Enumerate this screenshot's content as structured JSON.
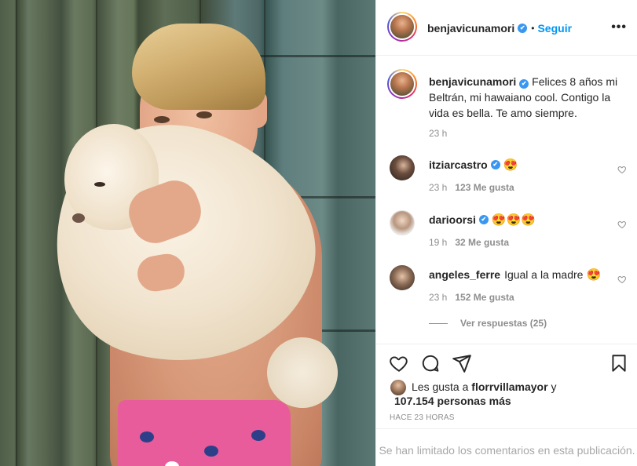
{
  "post": {
    "author": "benjavicunamori",
    "follow_label": "Seguir",
    "header_dot": "•",
    "more_label": "•••",
    "verified_mark": "✔",
    "caption": "Felices 8 años mi Beltrán, mi hawaiano cool. Contigo la vida es bella. Te amo siempre.",
    "caption_time": "23 h"
  },
  "comments": [
    {
      "user": "itziarcastro",
      "text": "",
      "emoji": "😍",
      "time": "23 h",
      "likes": "123 Me gusta",
      "avatar_color": "#3b2f2a"
    },
    {
      "user": "darioorsi",
      "text": "",
      "emoji": "😍😍😍",
      "time": "19 h",
      "likes": "32 Me gusta",
      "avatar_color": "#c9b7a6"
    },
    {
      "user": "angeles_ferre",
      "text": "Igual a la madre",
      "emoji": "😍",
      "time": "23 h",
      "likes": "152 Me gusta",
      "avatar_color": "#4a3a30"
    }
  ],
  "view_replies": "Ver respuestas (25)",
  "actions": {
    "like_icon": "heart-icon",
    "comment_icon": "comment-icon",
    "share_icon": "send-icon",
    "save_icon": "bookmark-icon"
  },
  "likes": {
    "prefix": "Les gusta a",
    "first_user": "florrvillamayor",
    "conjunction": "y",
    "others": "107.154 personas más"
  },
  "timestamp": "Hace 23 horas",
  "comments_limited": "Se han limitado los comentarios en esta publicación.",
  "colors": {
    "link_blue": "#0095f6",
    "verified_blue": "#3897f0",
    "muted_gray": "#8e8e8e",
    "border": "#efefef"
  }
}
